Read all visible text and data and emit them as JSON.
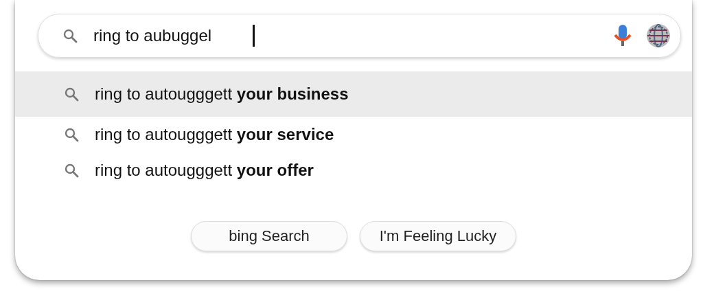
{
  "search": {
    "value": "ring to aubuggel"
  },
  "suggestions": [
    {
      "text": "ring to autougggett **your business**",
      "selected": true
    },
    {
      "text": "ring to autougggett **your service**",
      "selected": false
    },
    {
      "text": "ring to autougggett **your offer**",
      "selected": false
    }
  ],
  "buttons": [
    "bing Search",
    "I'm Feeling Lucky"
  ]
}
